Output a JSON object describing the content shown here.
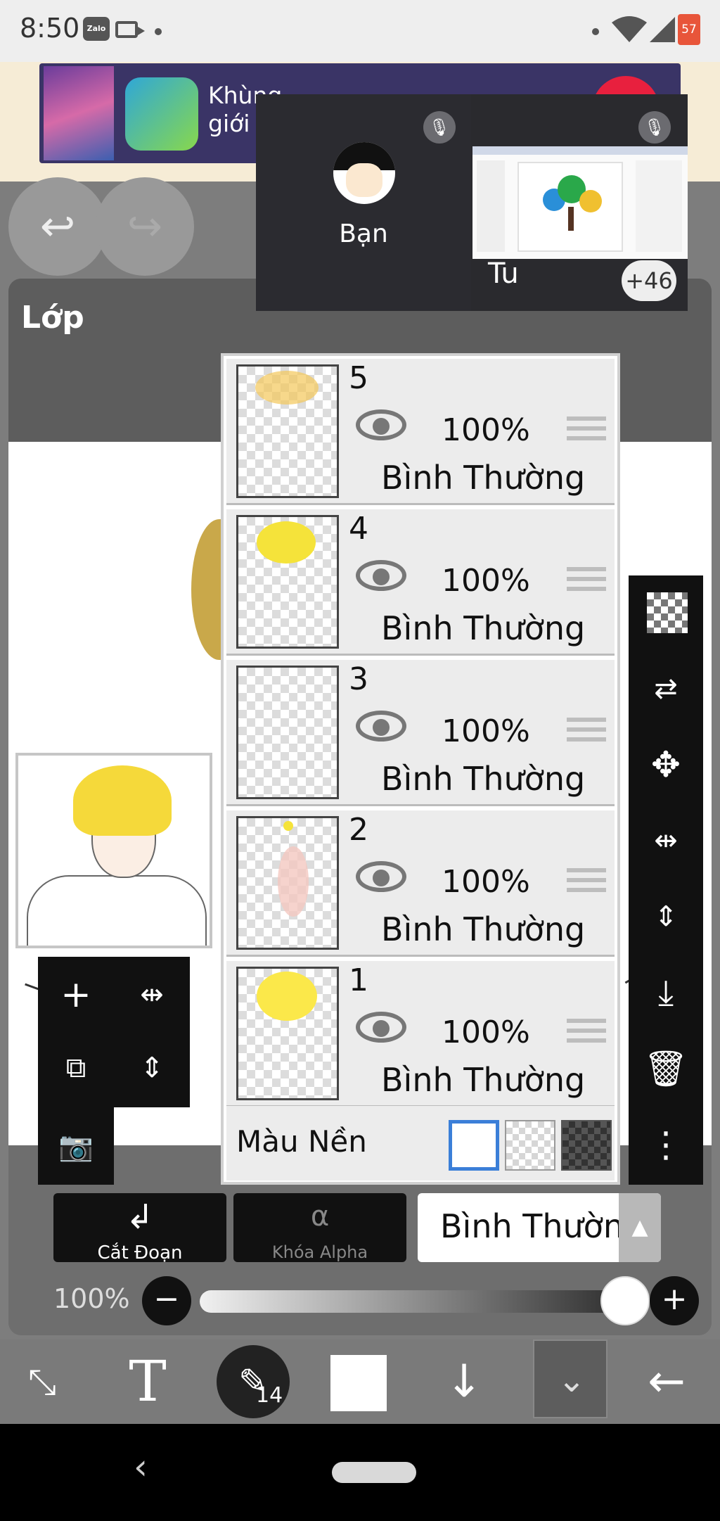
{
  "status_bar": {
    "time": "8:50",
    "zalo_label": "Zalo",
    "battery": "57"
  },
  "ad": {
    "text_line1": "Khùng",
    "text_line2": "giới"
  },
  "call": {
    "participant1": "Bạn",
    "participant2": "Tu",
    "more_count": "+46"
  },
  "panel": {
    "title": "Lớp"
  },
  "layers": [
    {
      "number": "5",
      "opacity": "100%",
      "mode": "Bình Thường"
    },
    {
      "number": "4",
      "opacity": "100%",
      "mode": "Bình Thường"
    },
    {
      "number": "3",
      "opacity": "100%",
      "mode": "Bình Thường"
    },
    {
      "number": "2",
      "opacity": "100%",
      "mode": "Bình Thường"
    },
    {
      "number": "1",
      "opacity": "100%",
      "mode": "Bình Thường"
    }
  ],
  "background_row": {
    "label": "Màu Nền"
  },
  "buttons": {
    "clip_label": "Cắt Đoạn",
    "alpha_lock_label": "Khóa Alpha"
  },
  "blend_mode": {
    "value": "Bình Thường"
  },
  "opacity": {
    "label": "100%",
    "value_fraction": 0.95
  },
  "tools": {
    "brush_size": "14"
  },
  "colors": {
    "accent": "#3b7fd8",
    "panel": "#6e6e6e",
    "toolbar": "#111111"
  }
}
